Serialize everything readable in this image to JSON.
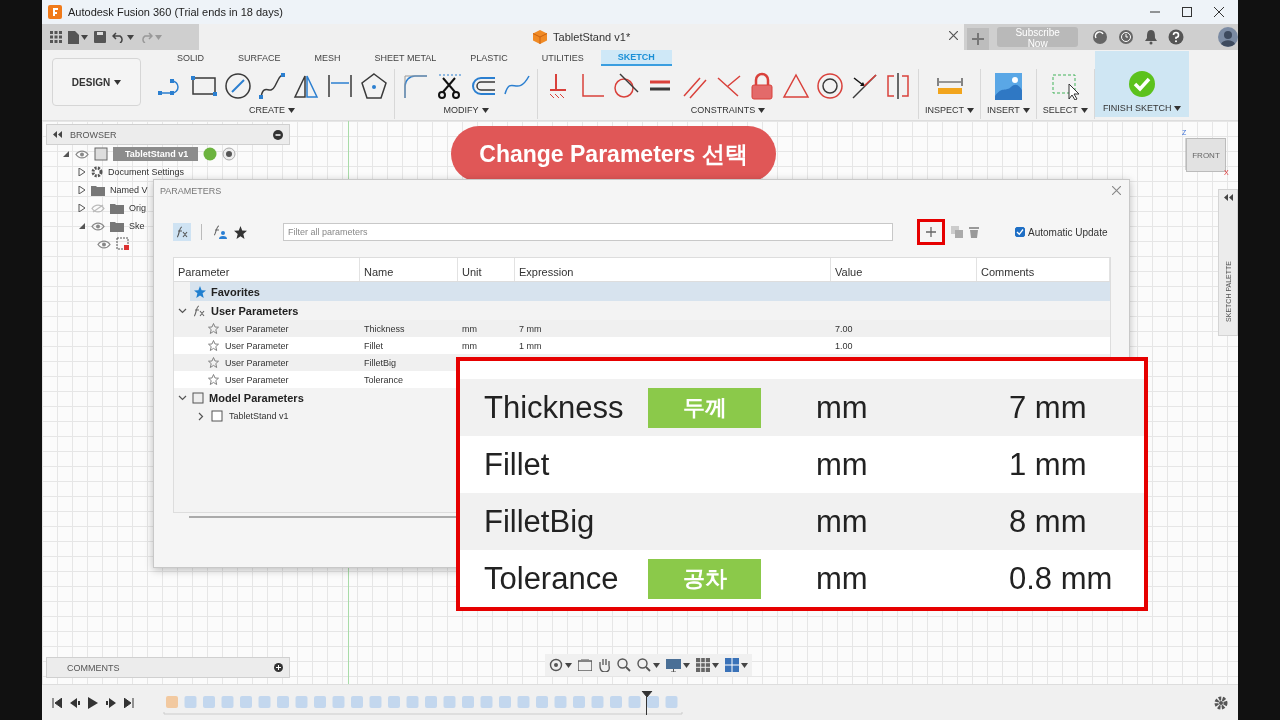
{
  "window": {
    "title": "Autodesk Fusion 360 (Trial ends in 18 days)"
  },
  "document_tab": {
    "title": "TabletStand v1*"
  },
  "subscribe_button": {
    "label": "Subscribe Now"
  },
  "workspace": {
    "label": "DESIGN"
  },
  "toolbar_tabs": [
    {
      "label": "SOLID",
      "selected": false
    },
    {
      "label": "SURFACE",
      "selected": false
    },
    {
      "label": "MESH",
      "selected": false
    },
    {
      "label": "SHEET METAL",
      "selected": false
    },
    {
      "label": "PLASTIC",
      "selected": false
    },
    {
      "label": "UTILITIES",
      "selected": false
    },
    {
      "label": "SKETCH",
      "selected": true
    }
  ],
  "tool_groups": [
    {
      "kind": "create",
      "label": "CREATE"
    },
    {
      "kind": "modify",
      "label": "MODIFY"
    },
    {
      "kind": "constraints",
      "label": "CONSTRAINTS"
    },
    {
      "kind": "inspect",
      "label": "INSPECT"
    },
    {
      "kind": "insert",
      "label": "INSERT"
    },
    {
      "kind": "select",
      "label": "SELECT"
    },
    {
      "kind": "finish",
      "label": "FINISH SKETCH"
    }
  ],
  "browser": {
    "title": "BROWSER",
    "items": [
      {
        "label": "TabletStand v1",
        "kind": "component",
        "visible": true,
        "expanded": true,
        "children": [
          {
            "label": "Document Settings",
            "kind": "settings",
            "expanded": false
          },
          {
            "label": "Named V",
            "kind": "folder",
            "expanded": false
          },
          {
            "label": "Orig",
            "kind": "folder",
            "visible": false,
            "expanded": false
          },
          {
            "label": "Ske",
            "kind": "folder",
            "visible": true,
            "expanded": true,
            "children": [
              {
                "kind": "sketch",
                "visible": true
              }
            ]
          }
        ]
      }
    ]
  },
  "callout": {
    "text": "Change Parameters 선택"
  },
  "view_cube": {
    "face": "FRONT",
    "axis_up": "Z",
    "axis_right": "X"
  },
  "sketch_palette": {
    "label": "SKETCH PALETTE"
  },
  "parameters_dialog": {
    "title": "PARAMETERS",
    "filter": {
      "placeholder": "Filter all parameters"
    },
    "automatic_update": {
      "label": "Automatic Update",
      "checked": true
    },
    "columns": [
      "Parameter",
      "Name",
      "Unit",
      "Expression",
      "Value",
      "Comments"
    ],
    "sections": [
      {
        "label": "Favorites",
        "kind": "favorites",
        "selected": true
      },
      {
        "label": "User Parameters",
        "kind": "user",
        "selected": false,
        "expanded": true,
        "rows": [
          {
            "parameter": "User Parameter",
            "name": "Thickness",
            "unit": "mm",
            "expression": "7 mm",
            "value": "7.00",
            "favorite": false
          },
          {
            "parameter": "User Parameter",
            "name": "Fillet",
            "unit": "mm",
            "expression": "1 mm",
            "value": "1.00",
            "favorite": false
          },
          {
            "parameter": "User Parameter",
            "name": "FilletBig",
            "favorite": false
          },
          {
            "parameter": "User Parameter",
            "name": "Tolerance",
            "favorite": false
          }
        ]
      },
      {
        "label": "Model Parameters",
        "kind": "model",
        "selected": false,
        "expanded": true,
        "children": [
          {
            "label": "TabletStand v1",
            "expanded": false
          }
        ]
      }
    ]
  },
  "zoom_callout": {
    "rows": [
      {
        "name": "Thickness",
        "note": "두께",
        "unit": "mm",
        "expression": "7 mm"
      },
      {
        "name": "Fillet",
        "unit": "mm",
        "expression": "1 mm"
      },
      {
        "name": "FilletBig",
        "unit": "mm",
        "expression": "8 mm"
      },
      {
        "name": "Tolerance",
        "note": "공차",
        "unit": "mm",
        "expression": "0.8 mm"
      }
    ]
  },
  "comments_panel": {
    "title": "COMMENTS"
  }
}
